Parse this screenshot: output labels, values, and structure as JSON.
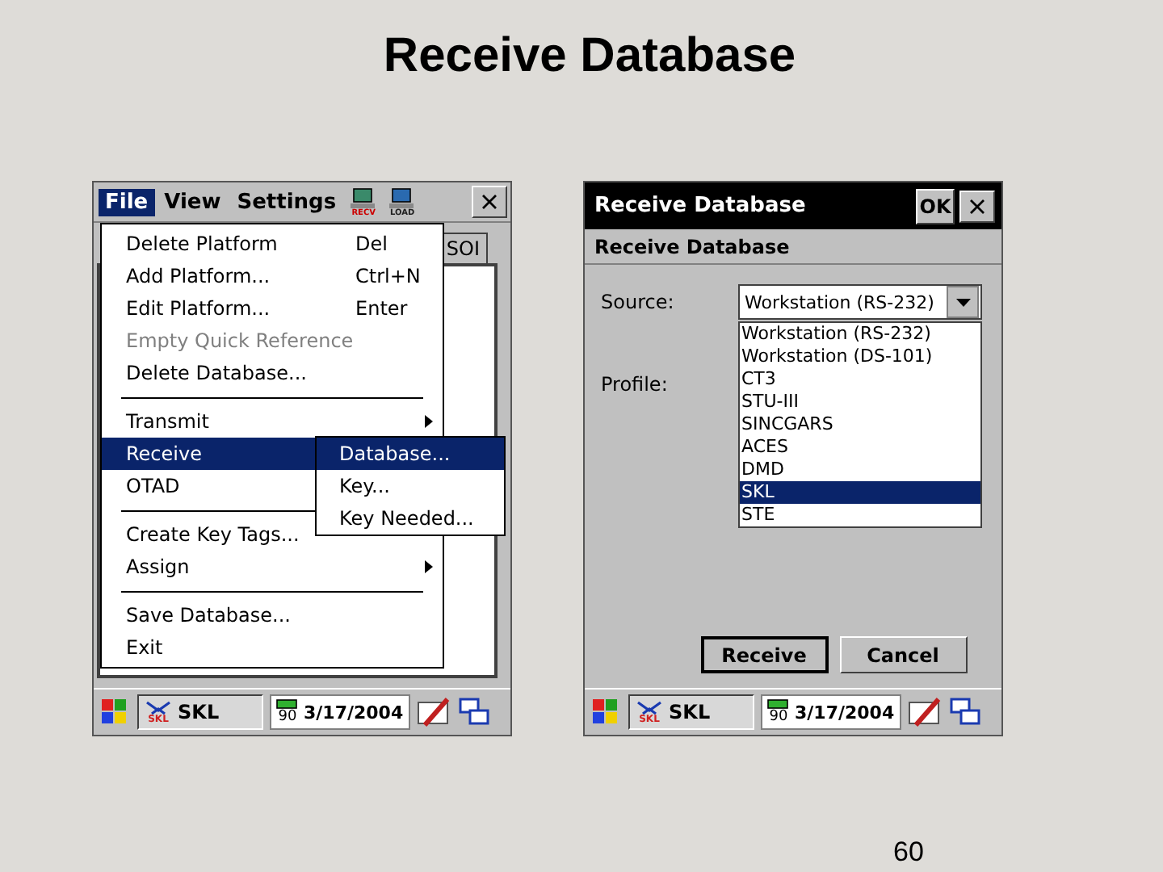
{
  "slide": {
    "title": "Receive Database",
    "page_number": "60"
  },
  "screens": [
    {
      "kind": "menu",
      "menubar": [
        {
          "label": "File",
          "selected": true
        },
        {
          "label": "View",
          "selected": false
        },
        {
          "label": "Settings",
          "selected": false
        }
      ],
      "toolbar_icons": [
        {
          "label": "RECV"
        },
        {
          "label": "LOAD"
        }
      ],
      "tab": "SOI",
      "menu": [
        {
          "kind": "item",
          "label": "Delete Platform",
          "shortcut": "Del",
          "disabled": false,
          "submenu": false,
          "selected": false
        },
        {
          "kind": "item",
          "label": "Add Platform...",
          "shortcut": "Ctrl+N",
          "disabled": false,
          "submenu": false,
          "selected": false
        },
        {
          "kind": "item",
          "label": "Edit Platform...",
          "shortcut": "Enter",
          "disabled": false,
          "submenu": false,
          "selected": false
        },
        {
          "kind": "item",
          "label": "Empty Quick Reference",
          "disabled": true,
          "submenu": false,
          "selected": false
        },
        {
          "kind": "item",
          "label": "Delete Database...",
          "disabled": false,
          "submenu": false,
          "selected": false
        },
        {
          "kind": "separator"
        },
        {
          "kind": "item",
          "label": "Transmit",
          "disabled": false,
          "submenu": true,
          "selected": false
        },
        {
          "kind": "item",
          "label": "Receive",
          "disabled": false,
          "submenu": false,
          "selected": true
        },
        {
          "kind": "item",
          "label": "OTAD",
          "disabled": false,
          "submenu": false,
          "selected": false
        },
        {
          "kind": "separator"
        },
        {
          "kind": "item",
          "label": "Create Key Tags...",
          "disabled": false,
          "submenu": false,
          "selected": false
        },
        {
          "kind": "item",
          "label": "Assign",
          "disabled": false,
          "submenu": true,
          "selected": false
        },
        {
          "kind": "separator"
        },
        {
          "kind": "item",
          "label": "Save Database...",
          "disabled": false,
          "submenu": false,
          "selected": false
        },
        {
          "kind": "item",
          "label": "Exit",
          "disabled": false,
          "submenu": false,
          "selected": false
        }
      ],
      "submenu": [
        {
          "label": "Database...",
          "selected": true
        },
        {
          "label": "Key...",
          "selected": false
        },
        {
          "label": "Key Needed...",
          "selected": false
        }
      ],
      "taskbar": {
        "app": "SKL",
        "app_icon_label": "SKL",
        "battery": "90",
        "date": "3/17/2004"
      }
    },
    {
      "kind": "dialog",
      "title": "Receive Database",
      "ok": "OK",
      "heading": "Receive Database",
      "source_label": "Source:",
      "source_value": "Workstation (RS-232)",
      "profile_label": "Profile:",
      "options": [
        {
          "label": "Workstation (RS-232)",
          "selected": false
        },
        {
          "label": "Workstation (DS-101)",
          "selected": false
        },
        {
          "label": "CT3",
          "selected": false
        },
        {
          "label": "STU-III",
          "selected": false
        },
        {
          "label": "SINCGARS",
          "selected": false
        },
        {
          "label": "ACES",
          "selected": false
        },
        {
          "label": "DMD",
          "selected": false
        },
        {
          "label": "SKL",
          "selected": true
        },
        {
          "label": "STE",
          "selected": false
        }
      ],
      "buttons": [
        "Receive",
        "Cancel"
      ],
      "taskbar": {
        "app": "SKL",
        "app_icon_label": "SKL",
        "battery": "90",
        "date": "3/17/2004"
      }
    }
  ]
}
